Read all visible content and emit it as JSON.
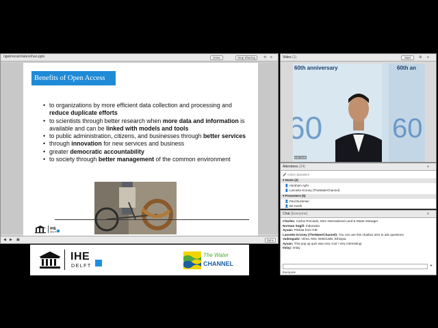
{
  "presentation": {
    "file_name": "ngwimessimlatennhan.pptx",
    "buttons": {
      "draw": "Draw",
      "stop_sharing": "Stop Sharing"
    },
    "slide": {
      "title": "Benefits of Open Access",
      "bullets": [
        [
          {
            "t": "to organizations by more efficient data collection and processing and "
          },
          {
            "t": "reduce duplicate efforts",
            "b": true
          }
        ],
        [
          {
            "t": "to scientists through better research when "
          },
          {
            "t": "more data and information",
            "b": true
          },
          {
            "t": " is available and can be "
          },
          {
            "t": "linked with models and tools",
            "b": true
          }
        ],
        [
          {
            "t": "to public administration, citizens, and businesses through "
          },
          {
            "t": "better services",
            "b": true
          }
        ],
        [
          {
            "t": "through "
          },
          {
            "t": "innovation",
            "b": true
          },
          {
            "t": " for new services and business"
          }
        ],
        [
          {
            "t": "greater "
          },
          {
            "t": "democratic accountability",
            "b": true
          }
        ],
        [
          {
            "t": "to society through "
          },
          {
            "t": "better management",
            "b": true
          },
          {
            "t": " of the common environment"
          }
        ]
      ],
      "logo_text": "IHE DELFT"
    },
    "footer_button": "Sync"
  },
  "banner": {
    "ihe_main": "IHE",
    "ihe_sub": "DELFT",
    "channel_line1": "The Water",
    "channel_line2": "CHANNEL"
  },
  "video": {
    "title": "Video",
    "count": "(1)",
    "start_label": "Start",
    "backdrop_text": "60th anniversary",
    "backdrop_text2": "60th an",
    "name_tag": "IHE Delft"
  },
  "attendees": {
    "title": "Attendees",
    "count": "(24)",
    "active_speakers_label": "Active Speakers",
    "hosts_label": "Hosts (2)",
    "hosts": [
      "Abraham Aphi",
      "Lanneke Kroney (TheWaterChannel)"
    ],
    "presenters_label": "Presenters (5)",
    "presenters": [
      "Paul Buckman",
      "Bil Geelh"
    ]
  },
  "chat": {
    "title": "Chat",
    "scope": "(Everyone)",
    "messages": [
      {
        "from": "Charles:",
        "text": " Carlos Preciado, MSc International Land & Water Manager"
      },
      {
        "from": "Norman Sugili:",
        "text": " Indonesia"
      },
      {
        "from": "Ayuan:",
        "text": " Pinikita from IHE"
      },
      {
        "from": "Lanneke Kroney (TheWaterChannel):",
        "text": " You can use this chatbox also to ask questions"
      },
      {
        "from": "Vadengado:",
        "text": " Vilma, MSc WSE/LWD, Ethiopia"
      },
      {
        "from": "Ayuan:",
        "text": " This pop up quiz was very cool ! very interesting!"
      },
      {
        "from": "Imlay:",
        "text": " Imlay"
      }
    ],
    "recipient_label": "Everyone"
  },
  "colors": {
    "slide_title_bg": "#1f8ad6",
    "banner_blue": "#1d8fe0",
    "channel_blue": "#1c5f9e",
    "channel_green": "#4fa83b"
  }
}
